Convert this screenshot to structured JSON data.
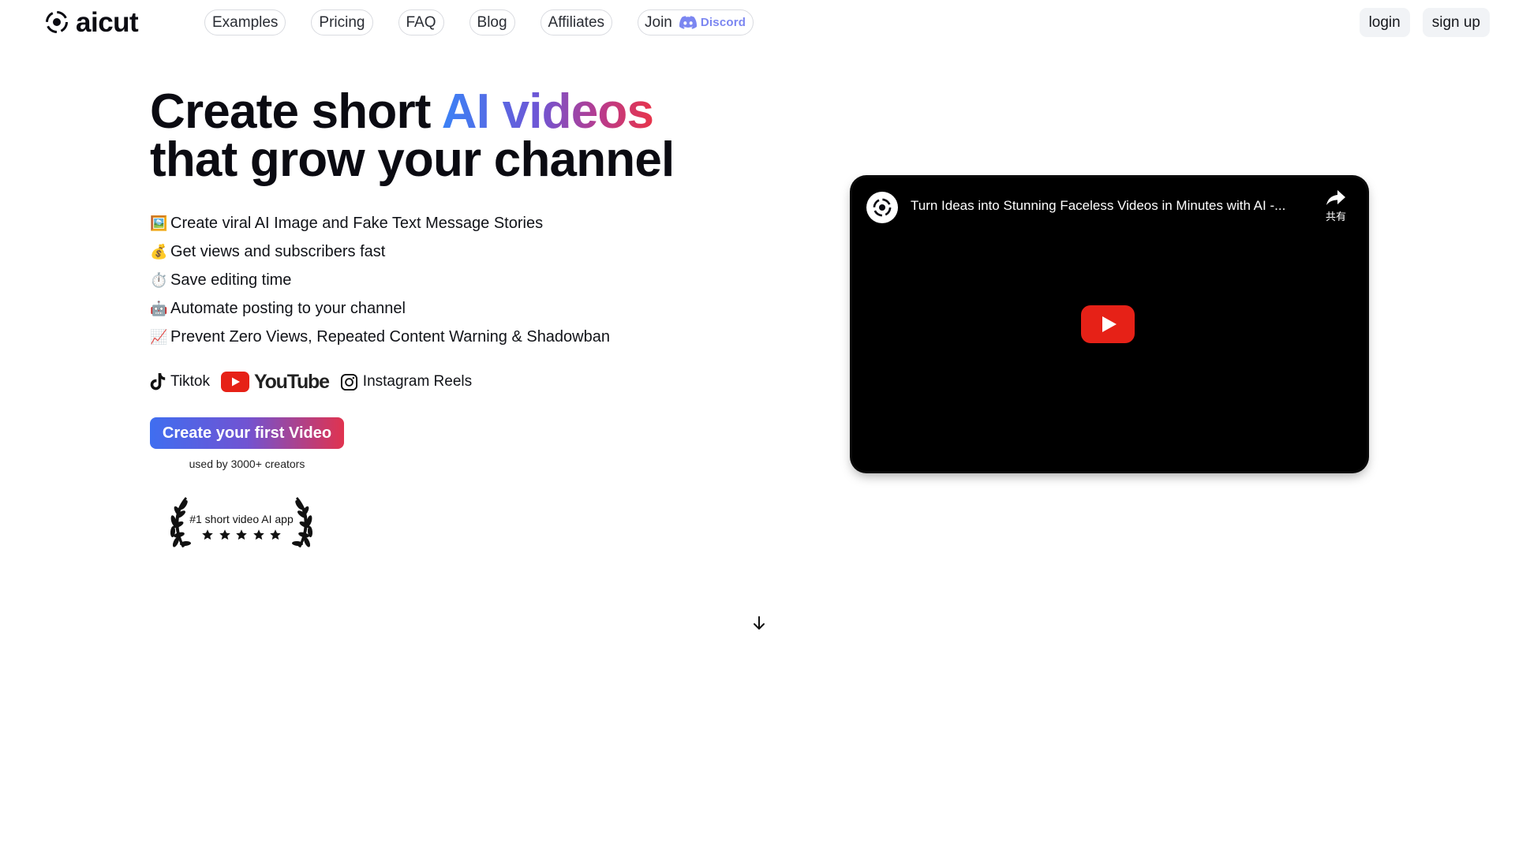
{
  "brand": {
    "name": "aicut"
  },
  "nav": {
    "items": [
      "Examples",
      "Pricing",
      "FAQ",
      "Blog",
      "Affiliates"
    ],
    "join_label": "Join",
    "discord_label": "Discord"
  },
  "auth": {
    "login": "login",
    "signup": "sign up"
  },
  "hero": {
    "title_line1_a": "Create short ",
    "title_line1_b": "AI videos",
    "title_line2": "that grow your channel"
  },
  "features": [
    {
      "icon": "framed-picture-icon",
      "emoji": "🖼️",
      "text": "Create viral AI Image and Fake Text Message Stories"
    },
    {
      "icon": "money-bag-icon",
      "emoji": "💰",
      "text": "Get views and subscribers fast"
    },
    {
      "icon": "stopwatch-icon",
      "emoji": "⏱️",
      "text": "Save editing time"
    },
    {
      "icon": "robot-icon",
      "emoji": "🤖",
      "text": "Automate posting to your channel"
    },
    {
      "icon": "chart-increasing-icon",
      "emoji": "📈",
      "text": "Prevent Zero Views, Repeated Content Warning & Shadowban"
    }
  ],
  "platforms": {
    "tiktok": "Tiktok",
    "youtube": "YouTube",
    "instagram": "Instagram Reels"
  },
  "cta": {
    "label": "Create your first Video",
    "subtext": "used by 3000+ creators"
  },
  "award": {
    "text": "#1 short video AI app",
    "stars": 5
  },
  "video": {
    "title": "Turn Ideas into Stunning Faceless Videos in Minutes with AI -...",
    "share_label": "共有"
  },
  "colors": {
    "gradient_start": "#3b82f6",
    "gradient_mid": "#6d57d6",
    "gradient_end": "#e8344a",
    "discord": "#7b86f1",
    "youtube_red": "#e62117"
  }
}
